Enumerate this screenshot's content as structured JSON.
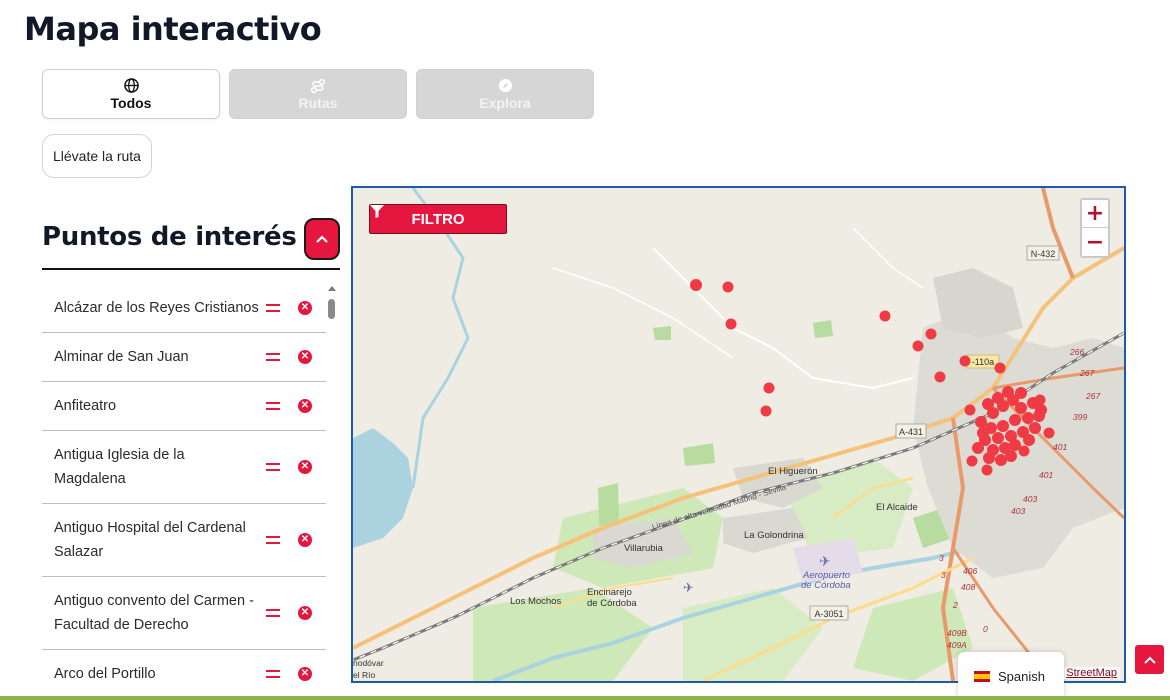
{
  "page": {
    "title": "Mapa interactivo"
  },
  "tabs": [
    {
      "label": "Todos",
      "icon": "globe-icon",
      "active": true
    },
    {
      "label": "Rutas",
      "icon": "route-icon",
      "active": false
    },
    {
      "label": "Explora",
      "icon": "compass-icon",
      "active": false
    }
  ],
  "take_route_label": "Llévate la ruta",
  "poi": {
    "title": "Puntos de interés",
    "items": [
      "Alcázar de los Reyes Cristianos",
      "Alminar de San Juan",
      "Anfiteatro",
      "Antigua Iglesia de la Magdalena",
      "Antiguo Hospital del Cardenal Salazar",
      "Antiguo convento del Carmen - Facultad de Derecho",
      "Arco del Portillo"
    ]
  },
  "map": {
    "filter_label": "FILTRO",
    "zoom_in": "+",
    "zoom_out": "−",
    "attribution": "StreetMap",
    "labels": {
      "n432": "N-432",
      "a431": "A-431",
      "a3051": "A-3051",
      "road110a": "-110a",
      "higueron": "El Higuerón",
      "alcaide": "El Alcaide",
      "golondrina": "La Golondrina",
      "villarrubia": "Villarubia",
      "mochos": "Los Mochos",
      "encinarejo1": "Encinarejo",
      "encinarejo2": "de Córdoba",
      "aeropuerto1": "Aeropuerto",
      "aeropuerto2": "de Córdoba",
      "railway": "Línea de alta velocidad Madrid - Sevilla",
      "almodovar1": "nodóvar",
      "almodovar2": "el Río",
      "k266": "266",
      "k267": "267",
      "k267b": "267",
      "k399": "399",
      "k401": "401",
      "k401b": "401",
      "k403": "403",
      "k403b": "403",
      "k406": "406",
      "k408": "408",
      "k409b": "409B",
      "k409a": "409A",
      "k3": "3",
      "k3b": "3",
      "k2": "2",
      "k0": "0"
    }
  },
  "language": {
    "label": "Spanish",
    "flag": "spain-flag-icon"
  },
  "colors": {
    "accent": "#e5173f",
    "map_border": "#1d5ba8",
    "marker": "#f03a44"
  }
}
